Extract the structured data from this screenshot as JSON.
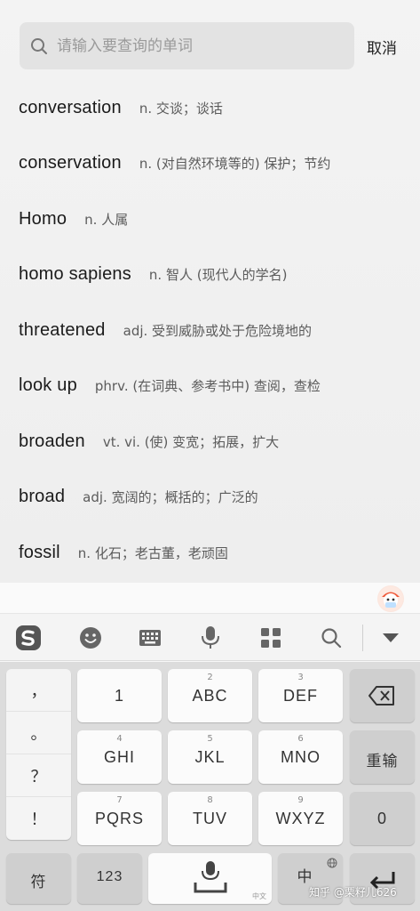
{
  "search": {
    "placeholder": "请输入要查询的单词",
    "cancel_label": "取消"
  },
  "results": [
    {
      "word": "conversation",
      "definition": "n. 交谈；谈话"
    },
    {
      "word": "conservation",
      "definition": "n. (对自然环境等的) 保护；节约"
    },
    {
      "word": "Homo",
      "definition": "n. 人属"
    },
    {
      "word": "homo sapiens",
      "definition": "n. 智人 (现代人的学名)"
    },
    {
      "word": "threatened",
      "definition": "adj. 受到威胁或处于危险境地的"
    },
    {
      "word": "look up",
      "definition": "phrv. (在词典、参考书中) 查阅，查检"
    },
    {
      "word": "broaden",
      "definition": "vt. vi. (使) 变宽；拓展，扩大"
    },
    {
      "word": "broad",
      "definition": "adj. 宽阔的；概括的；广泛的"
    },
    {
      "word": "fossil",
      "definition": "n. 化石；老古董，老顽固"
    }
  ],
  "keyboard": {
    "toolbar_icons": [
      "sogou-logo-icon",
      "emoji-icon",
      "keyboard-icon",
      "microphone-icon",
      "grid-icon",
      "search-icon",
      "collapse-icon"
    ],
    "punctuation": [
      "，",
      "。",
      "？",
      "！"
    ],
    "keys": {
      "k1": {
        "label": "1"
      },
      "k2": {
        "label": "ABC",
        "num": "2"
      },
      "k3": {
        "label": "DEF",
        "num": "3"
      },
      "k4": {
        "label": "GHI",
        "num": "4"
      },
      "k5": {
        "label": "JKL",
        "num": "5"
      },
      "k6": {
        "label": "MNO",
        "num": "6"
      },
      "k7": {
        "label": "PQRS",
        "num": "7"
      },
      "k8": {
        "label": "TUV",
        "num": "8"
      },
      "k9": {
        "label": "WXYZ",
        "num": "9"
      },
      "reinput": {
        "label": "重输"
      },
      "zero": {
        "label": "0"
      },
      "symbols": {
        "label": "符"
      },
      "numbers": {
        "label": "123"
      },
      "space_hint": "中文",
      "lang": {
        "label": "中"
      }
    }
  },
  "watermark": "知乎 @栗籽儿626"
}
